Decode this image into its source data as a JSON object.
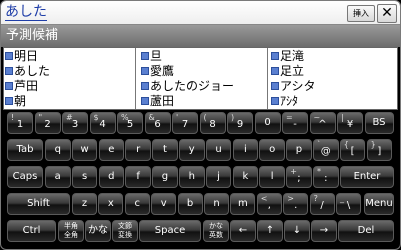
{
  "input": {
    "text": "あした"
  },
  "topbar": {
    "insert_label": "挿入",
    "close_label": "✕"
  },
  "candidates": {
    "header": "予測候補",
    "columns": [
      [
        "明日",
        "あした",
        "芦田",
        "朝"
      ],
      [
        "旦",
        "愛鷹",
        "あしたのジョー",
        "蘆田"
      ],
      [
        "足滝",
        "足立",
        "アシタ",
        "ｱｼﾀ"
      ]
    ]
  },
  "keyboard": {
    "rows": [
      [
        {
          "main": "1",
          "sup": "!"
        },
        {
          "main": "2",
          "sup": "\""
        },
        {
          "main": "3",
          "sup": "#"
        },
        {
          "main": "4",
          "sup": "$"
        },
        {
          "main": "5",
          "sup": "%"
        },
        {
          "main": "6",
          "sup": "&"
        },
        {
          "main": "7",
          "sup": "'"
        },
        {
          "main": "8",
          "sup": "("
        },
        {
          "main": "9",
          "sup": ")"
        },
        {
          "main": "0",
          "sup": ""
        },
        {
          "main": "-",
          "sup": "="
        },
        {
          "main": "^",
          "sup": "~"
        },
        {
          "main": "¥",
          "sup": "|"
        },
        {
          "main": "BS",
          "sup": ""
        }
      ],
      [
        {
          "main": "Tab"
        },
        {
          "main": "q"
        },
        {
          "main": "w"
        },
        {
          "main": "e"
        },
        {
          "main": "r"
        },
        {
          "main": "t"
        },
        {
          "main": "y"
        },
        {
          "main": "u"
        },
        {
          "main": "i"
        },
        {
          "main": "o"
        },
        {
          "main": "p"
        },
        {
          "main": "@",
          "sup": "`"
        },
        {
          "main": "[",
          "sup": "{"
        },
        {
          "main": "]",
          "sup": "}"
        }
      ],
      [
        {
          "main": "Caps"
        },
        {
          "main": "a"
        },
        {
          "main": "s"
        },
        {
          "main": "d"
        },
        {
          "main": "f"
        },
        {
          "main": "g"
        },
        {
          "main": "h"
        },
        {
          "main": "j"
        },
        {
          "main": "k"
        },
        {
          "main": "l"
        },
        {
          "main": ";",
          "sup": "+"
        },
        {
          "main": ":",
          "sup": "*"
        },
        {
          "main": "Enter"
        }
      ],
      [
        {
          "main": "Shift"
        },
        {
          "main": "z"
        },
        {
          "main": "x"
        },
        {
          "main": "c"
        },
        {
          "main": "v"
        },
        {
          "main": "b"
        },
        {
          "main": "n"
        },
        {
          "main": "m"
        },
        {
          "main": ",",
          "sup": "<"
        },
        {
          "main": ".",
          "sup": ">"
        },
        {
          "main": "/",
          "sup": "?"
        },
        {
          "main": "\\",
          "sup": "_"
        },
        {
          "main": "Menu"
        }
      ],
      [
        {
          "main": "Ctrl"
        },
        {
          "main": "半角\n全角"
        },
        {
          "main": "かな"
        },
        {
          "main": "文節\n変換"
        },
        {
          "main": "Space"
        },
        {
          "main": "かな\n英数"
        },
        {
          "main": "←"
        },
        {
          "main": "↑"
        },
        {
          "main": "↓"
        },
        {
          "main": "→"
        },
        {
          "main": "Del"
        }
      ]
    ]
  }
}
